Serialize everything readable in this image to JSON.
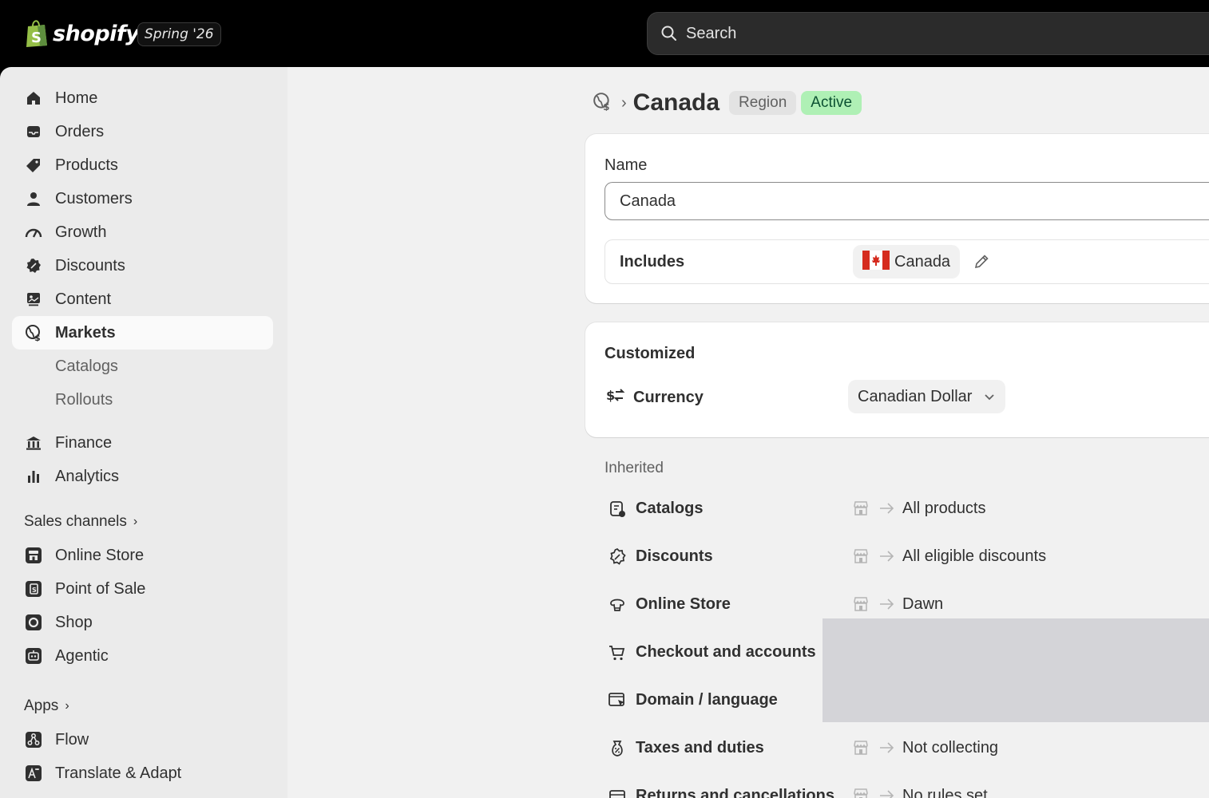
{
  "topbar": {
    "brand": "shopify",
    "edition": "Spring '26",
    "search_placeholder": "Search"
  },
  "sidebar": {
    "items": [
      {
        "label": "Home",
        "icon": "home-icon"
      },
      {
        "label": "Orders",
        "icon": "inbox-icon"
      },
      {
        "label": "Products",
        "icon": "tag-icon"
      },
      {
        "label": "Customers",
        "icon": "person-icon"
      },
      {
        "label": "Growth",
        "icon": "gauge-icon"
      },
      {
        "label": "Discounts",
        "icon": "discount-badge-icon"
      },
      {
        "label": "Content",
        "icon": "image-icon"
      },
      {
        "label": "Markets",
        "icon": "globe-icon",
        "active": true
      }
    ],
    "markets_sub": [
      "Catalogs",
      "Rollouts"
    ],
    "items2": [
      {
        "label": "Finance",
        "icon": "bank-icon"
      },
      {
        "label": "Analytics",
        "icon": "bar-chart-icon"
      }
    ],
    "sales_channels_label": "Sales channels",
    "channels": [
      {
        "label": "Online Store",
        "icon": "storefront-icon"
      },
      {
        "label": "Point of Sale",
        "icon": "pos-icon"
      },
      {
        "label": "Shop",
        "icon": "shop-icon"
      },
      {
        "label": "Agentic",
        "icon": "robot-icon"
      }
    ],
    "apps_label": "Apps",
    "apps": [
      {
        "label": "Flow",
        "icon": "flow-icon"
      },
      {
        "label": "Translate & Adapt",
        "icon": "translate-icon"
      }
    ]
  },
  "page": {
    "title": "Canada",
    "badge_type": "Region",
    "badge_status": "Active",
    "badge_status_color": "#aff0b5"
  },
  "details": {
    "name_label": "Name",
    "name_value": "Canada",
    "includes_label": "Includes",
    "includes_country": "Canada"
  },
  "customized": {
    "title": "Customized",
    "currency_label": "Currency",
    "currency_value": "Canadian Dollar"
  },
  "inherited": {
    "title": "Inherited",
    "rows": [
      {
        "label": "Catalogs",
        "value": "All products",
        "icon": "catalog-icon"
      },
      {
        "label": "Discounts",
        "value": "All eligible discounts",
        "icon": "discount-icon"
      },
      {
        "label": "Online Store",
        "value": "Dawn",
        "icon": "theme-icon"
      },
      {
        "label": "Checkout and accounts",
        "value": "",
        "icon": "cart-icon"
      },
      {
        "label": "Domain / language",
        "value": "",
        "icon": "domain-icon"
      },
      {
        "label": "Taxes and duties",
        "value": "Not collecting",
        "icon": "tax-bag-icon"
      },
      {
        "label": "Returns and cancellations",
        "value": "No rules set",
        "icon": "returns-icon"
      }
    ]
  }
}
